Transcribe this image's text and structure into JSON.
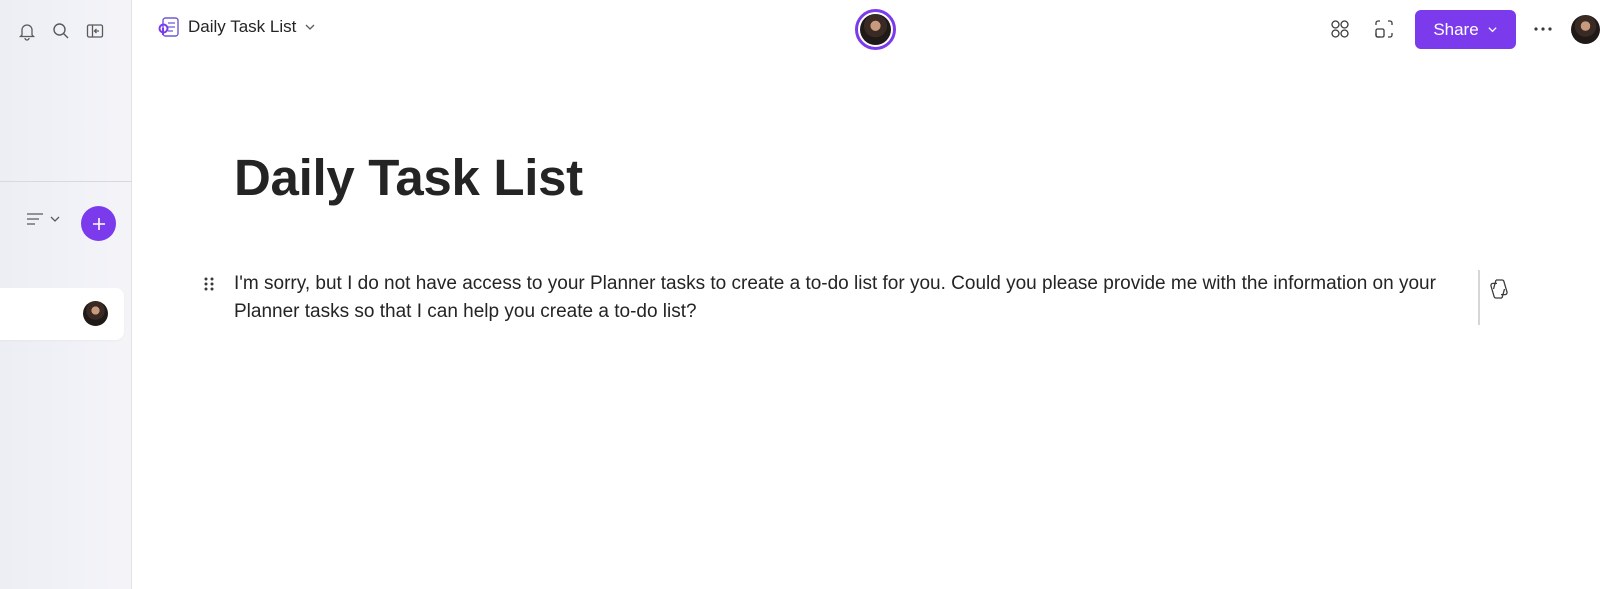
{
  "document": {
    "title": "Daily Task List",
    "heading": "Daily Task List",
    "paragraph": "I'm sorry, but I do not have access to your Planner tasks to create a to-do list for you. Could you please provide me with the information on your Planner tasks so that I can help you create a to-do list?"
  },
  "toolbar": {
    "share_label": "Share"
  },
  "icons": {
    "notifications": "bell-icon",
    "search": "search-icon",
    "collapse_sidebar": "collapse-sidebar-icon",
    "sort": "sort-icon",
    "add": "plus-icon",
    "app": "loop-icon",
    "apps": "apps-icon",
    "focus": "focus-mode-icon",
    "more": "more-icon",
    "drag": "drag-handle-icon",
    "copilot": "copilot-icon"
  },
  "colors": {
    "accent": "#7c3aed",
    "sidebar_bg": "#eef0f5",
    "text": "#242424"
  }
}
